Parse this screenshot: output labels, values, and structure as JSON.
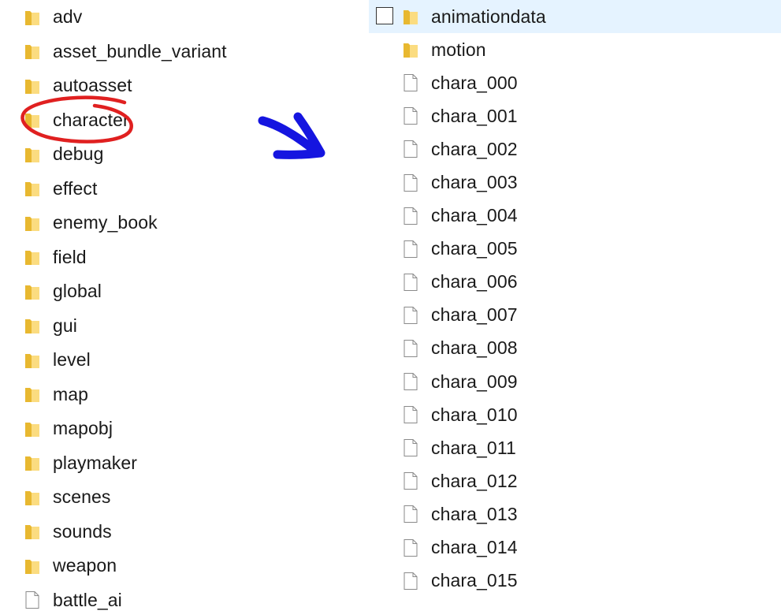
{
  "left_pane": {
    "items": [
      {
        "label": "adv",
        "icon": "folder-icon"
      },
      {
        "label": "asset_bundle_variant",
        "icon": "folder-icon"
      },
      {
        "label": "autoasset",
        "icon": "folder-icon"
      },
      {
        "label": "character",
        "icon": "folder-icon"
      },
      {
        "label": "debug",
        "icon": "folder-icon"
      },
      {
        "label": "effect",
        "icon": "folder-icon"
      },
      {
        "label": "enemy_book",
        "icon": "folder-icon"
      },
      {
        "label": "field",
        "icon": "folder-icon"
      },
      {
        "label": "global",
        "icon": "folder-icon"
      },
      {
        "label": "gui",
        "icon": "folder-icon"
      },
      {
        "label": "level",
        "icon": "folder-icon"
      },
      {
        "label": "map",
        "icon": "folder-icon"
      },
      {
        "label": "mapobj",
        "icon": "folder-icon"
      },
      {
        "label": "playmaker",
        "icon": "folder-icon"
      },
      {
        "label": "scenes",
        "icon": "folder-icon"
      },
      {
        "label": "sounds",
        "icon": "folder-icon"
      },
      {
        "label": "weapon",
        "icon": "folder-icon"
      },
      {
        "label": "battle_ai",
        "icon": "file-icon"
      }
    ]
  },
  "right_pane": {
    "items": [
      {
        "label": "animationdata",
        "icon": "folder-icon",
        "selected": true
      },
      {
        "label": "motion",
        "icon": "folder-icon"
      },
      {
        "label": "chara_000",
        "icon": "file-icon"
      },
      {
        "label": "chara_001",
        "icon": "file-icon"
      },
      {
        "label": "chara_002",
        "icon": "file-icon"
      },
      {
        "label": "chara_003",
        "icon": "file-icon"
      },
      {
        "label": "chara_004",
        "icon": "file-icon"
      },
      {
        "label": "chara_005",
        "icon": "file-icon"
      },
      {
        "label": "chara_006",
        "icon": "file-icon"
      },
      {
        "label": "chara_007",
        "icon": "file-icon"
      },
      {
        "label": "chara_008",
        "icon": "file-icon"
      },
      {
        "label": "chara_009",
        "icon": "file-icon"
      },
      {
        "label": "chara_010",
        "icon": "file-icon"
      },
      {
        "label": "chara_011",
        "icon": "file-icon"
      },
      {
        "label": "chara_012",
        "icon": "file-icon"
      },
      {
        "label": "chara_013",
        "icon": "file-icon"
      },
      {
        "label": "chara_014",
        "icon": "file-icon"
      },
      {
        "label": "chara_015",
        "icon": "file-icon"
      }
    ]
  },
  "colors": {
    "selection": "#e5f3ff",
    "highlight_circle": "#e02020",
    "arrow": "#1515e0",
    "folder_body": "#f8d775",
    "folder_tab": "#e8b830"
  }
}
